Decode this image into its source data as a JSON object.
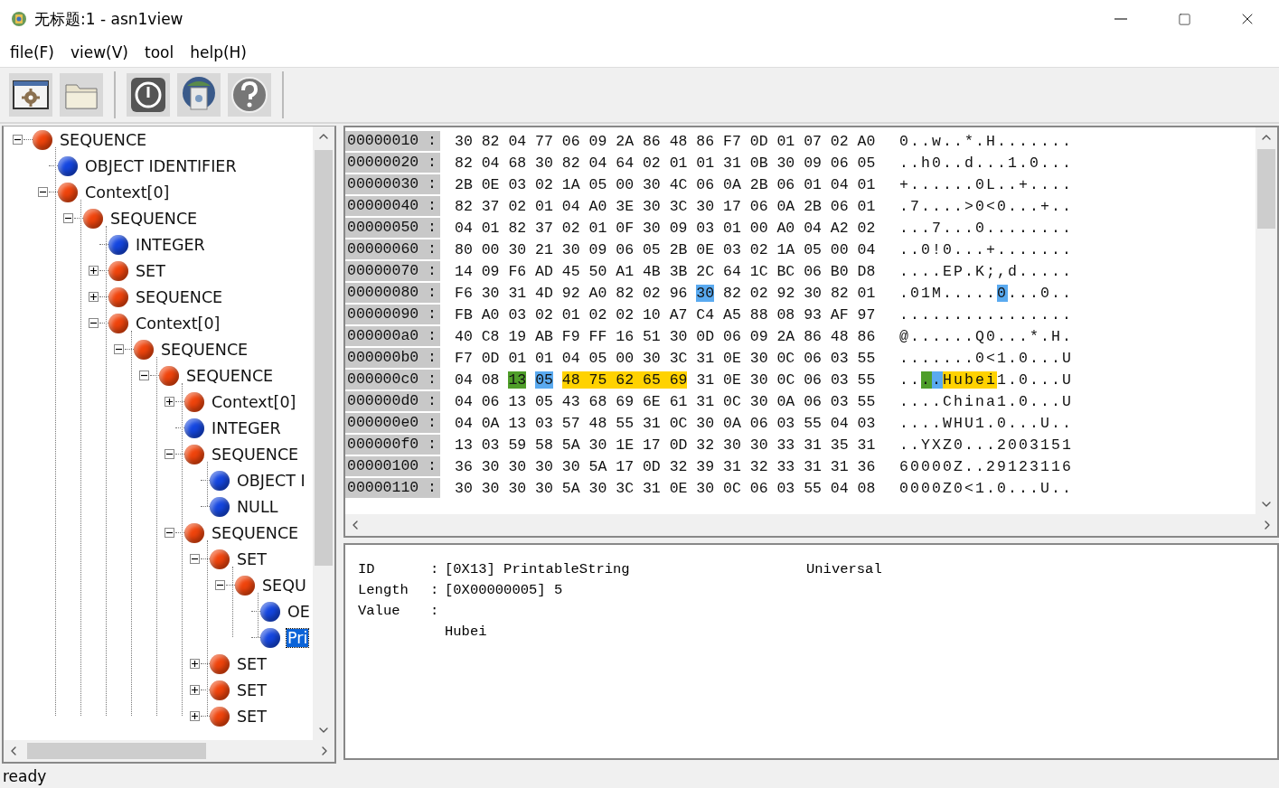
{
  "window": {
    "title": "无标题:1 - asn1view"
  },
  "menu": [
    "file(F)",
    "view(V)",
    "tool",
    "help(H)"
  ],
  "tree": [
    {
      "label": "SEQUENCE",
      "kind": "constructed",
      "expanded": true,
      "selected": false,
      "children": [
        {
          "label": "OBJECT IDENTIFIER",
          "kind": "primitive",
          "selected": false
        },
        {
          "label": "Context[0]",
          "kind": "constructed",
          "expanded": true,
          "selected": false,
          "children": [
            {
              "label": "SEQUENCE",
              "kind": "constructed",
              "expanded": true,
              "selected": false,
              "children": [
                {
                  "label": "INTEGER",
                  "kind": "primitive",
                  "selected": false
                },
                {
                  "label": "SET",
                  "kind": "constructed",
                  "expanded": false,
                  "selected": false
                },
                {
                  "label": "SEQUENCE",
                  "kind": "constructed",
                  "expanded": false,
                  "selected": false
                },
                {
                  "label": "Context[0]",
                  "kind": "constructed",
                  "expanded": true,
                  "selected": false,
                  "children": [
                    {
                      "label": "SEQUENCE",
                      "kind": "constructed",
                      "expanded": true,
                      "selected": false,
                      "children": [
                        {
                          "label": "SEQUENCE",
                          "kind": "constructed",
                          "expanded": true,
                          "selected": false,
                          "children": [
                            {
                              "label": "Context[0]",
                              "kind": "constructed",
                              "expanded": false,
                              "selected": false
                            },
                            {
                              "label": "INTEGER",
                              "kind": "primitive",
                              "selected": false
                            },
                            {
                              "label": "SEQUENCE",
                              "kind": "constructed",
                              "expanded": true,
                              "selected": false,
                              "children": [
                                {
                                  "label": "OBJECT I",
                                  "kind": "primitive",
                                  "selected": false
                                },
                                {
                                  "label": "NULL",
                                  "kind": "primitive",
                                  "selected": false
                                }
                              ]
                            },
                            {
                              "label": "SEQUENCE",
                              "kind": "constructed",
                              "expanded": true,
                              "selected": false,
                              "children": [
                                {
                                  "label": "SET",
                                  "kind": "constructed",
                                  "expanded": true,
                                  "selected": false,
                                  "children": [
                                    {
                                      "label": "SEQU",
                                      "kind": "constructed",
                                      "expanded": true,
                                      "selected": false,
                                      "children": [
                                        {
                                          "label": "OE",
                                          "kind": "primitive",
                                          "selected": false
                                        },
                                        {
                                          "label": "Pri",
                                          "kind": "primitive",
                                          "selected": true
                                        }
                                      ]
                                    }
                                  ]
                                },
                                {
                                  "label": "SET",
                                  "kind": "constructed",
                                  "expanded": false,
                                  "selected": false
                                },
                                {
                                  "label": "SET",
                                  "kind": "constructed",
                                  "expanded": false,
                                  "selected": false
                                },
                                {
                                  "label": "SET",
                                  "kind": "constructed",
                                  "expanded": false,
                                  "selected": false
                                }
                              ]
                            }
                          ]
                        }
                      ]
                    }
                  ]
                }
              ]
            }
          ]
        }
      ]
    }
  ],
  "hex_rows": [
    {
      "address": "00000010 :",
      "bytes": [
        {
          "text": "30 82 04 77 06 09 2A 86 48 86 F7 0D 01 07 02 A0"
        }
      ],
      "ascii": [
        {
          "text": "0..w..*.H......."
        }
      ]
    },
    {
      "address": "00000020 :",
      "bytes": [
        {
          "text": "82 04 68 30 82 04 64 02 01 01 31 0B 30 09 06 05"
        }
      ],
      "ascii": [
        {
          "text": "..h0..d...1.0..."
        }
      ]
    },
    {
      "address": "00000030 :",
      "bytes": [
        {
          "text": "2B 0E 03 02 1A 05 00 30 4C 06 0A 2B 06 01 04 01"
        }
      ],
      "ascii": [
        {
          "text": "+......0L..+...."
        }
      ]
    },
    {
      "address": "00000040 :",
      "bytes": [
        {
          "text": "82 37 02 01 04 A0 3E 30 3C 30 17 06 0A 2B 06 01"
        }
      ],
      "ascii": [
        {
          "text": ".7....>0<0...+.."
        }
      ]
    },
    {
      "address": "00000050 :",
      "bytes": [
        {
          "text": "04 01 82 37 02 01 0F 30 09 03 01 00 A0 04 A2 02"
        }
      ],
      "ascii": [
        {
          "text": "...7...0........"
        }
      ]
    },
    {
      "address": "00000060 :",
      "bytes": [
        {
          "text": "80 00 30 21 30 09 06 05 2B 0E 03 02 1A 05 00 04"
        }
      ],
      "ascii": [
        {
          "text": "..0!0...+......."
        }
      ]
    },
    {
      "address": "00000070 :",
      "bytes": [
        {
          "text": "14 09 F6 AD 45 50 A1 4B 3B 2C 64 1C BC 06 B0 D8"
        }
      ],
      "ascii": [
        {
          "text": "....EP.K;,d....."
        }
      ]
    },
    {
      "address": "00000080 :",
      "bytes": [
        {
          "text": "F6 30 31 4D 92 A0 82 02 96"
        },
        {
          "text": "30",
          "color": "#5aaaf0"
        },
        {
          "text": "82 02 92 30 82 01"
        }
      ],
      "ascii": [
        {
          "text": ".01M....."
        },
        {
          "text": "0",
          "color": "#5aaaf0"
        },
        {
          "text": "...0.."
        }
      ]
    },
    {
      "address": "00000090 :",
      "bytes": [
        {
          "text": "FB A0 03 02 01 02 02 10 A7 C4 A5 88 08 93 AF 97"
        }
      ],
      "ascii": [
        {
          "text": "................"
        }
      ]
    },
    {
      "address": "000000a0 :",
      "bytes": [
        {
          "text": "40 C8 19 AB F9 FF 16 51 30 0D 06 09 2A 86 48 86"
        }
      ],
      "ascii": [
        {
          "text": "@......Q0...*.H."
        }
      ]
    },
    {
      "address": "000000b0 :",
      "bytes": [
        {
          "text": "F7 0D 01 01 04 05 00 30 3C 31 0E 30 0C 06 03 55"
        }
      ],
      "ascii": [
        {
          "text": ".......0<1.0...U"
        }
      ]
    },
    {
      "address": "000000c0 :",
      "bytes": [
        {
          "text": "04 08"
        },
        {
          "text": "13",
          "color": "#4f9e2a"
        },
        {
          "text": "05",
          "color": "#5aaaf0"
        },
        {
          "text": "48 75 62 65 69",
          "color": "#ffd200"
        },
        {
          "text": "31 0E 30 0C 06 03 55"
        }
      ],
      "ascii": [
        {
          "text": ".."
        },
        {
          "text": ".",
          "color": "#4f9e2a"
        },
        {
          "text": ".",
          "color": "#5aaaf0"
        },
        {
          "text": "Hubei",
          "color": "#ffd200"
        },
        {
          "text": "1.0...U"
        }
      ]
    },
    {
      "address": "000000d0 :",
      "bytes": [
        {
          "text": "04 06 13 05 43 68 69 6E 61 31 0C 30 0A 06 03 55"
        }
      ],
      "ascii": [
        {
          "text": "....China1.0...U"
        }
      ]
    },
    {
      "address": "000000e0 :",
      "bytes": [
        {
          "text": "04 0A 13 03 57 48 55 31 0C 30 0A 06 03 55 04 03"
        }
      ],
      "ascii": [
        {
          "text": "....WHU1.0...U.."
        }
      ]
    },
    {
      "address": "000000f0 :",
      "bytes": [
        {
          "text": "13 03 59 58 5A 30 1E 17 0D 32 30 30 33 31 35 31"
        }
      ],
      "ascii": [
        {
          "text": "..YXZ0...2003151"
        }
      ]
    },
    {
      "address": "00000100 :",
      "bytes": [
        {
          "text": "36 30 30 30 30 5A 17 0D 32 39 31 32 33 31 31 36"
        }
      ],
      "ascii": [
        {
          "text": "60000Z..29123116"
        }
      ]
    },
    {
      "address": "00000110 :",
      "bytes": [
        {
          "text": "30 30 30 30 5A 30 3C 31 0E 30 0C 06 03 55 04 08"
        }
      ],
      "ascii": [
        {
          "text": "0000Z0<1.0...U.."
        }
      ]
    }
  ],
  "detail": {
    "id_colon": ":",
    "length_colon": ":",
    "value_colon": ":",
    "id_label": "ID",
    "id_value": "[0X13] PrintableString",
    "tag_class": "Universal",
    "length_label": "Length",
    "length_value": "[0X00000005] 5",
    "value_label": "Value",
    "value": "Hubei"
  },
  "status_bar": "ready"
}
